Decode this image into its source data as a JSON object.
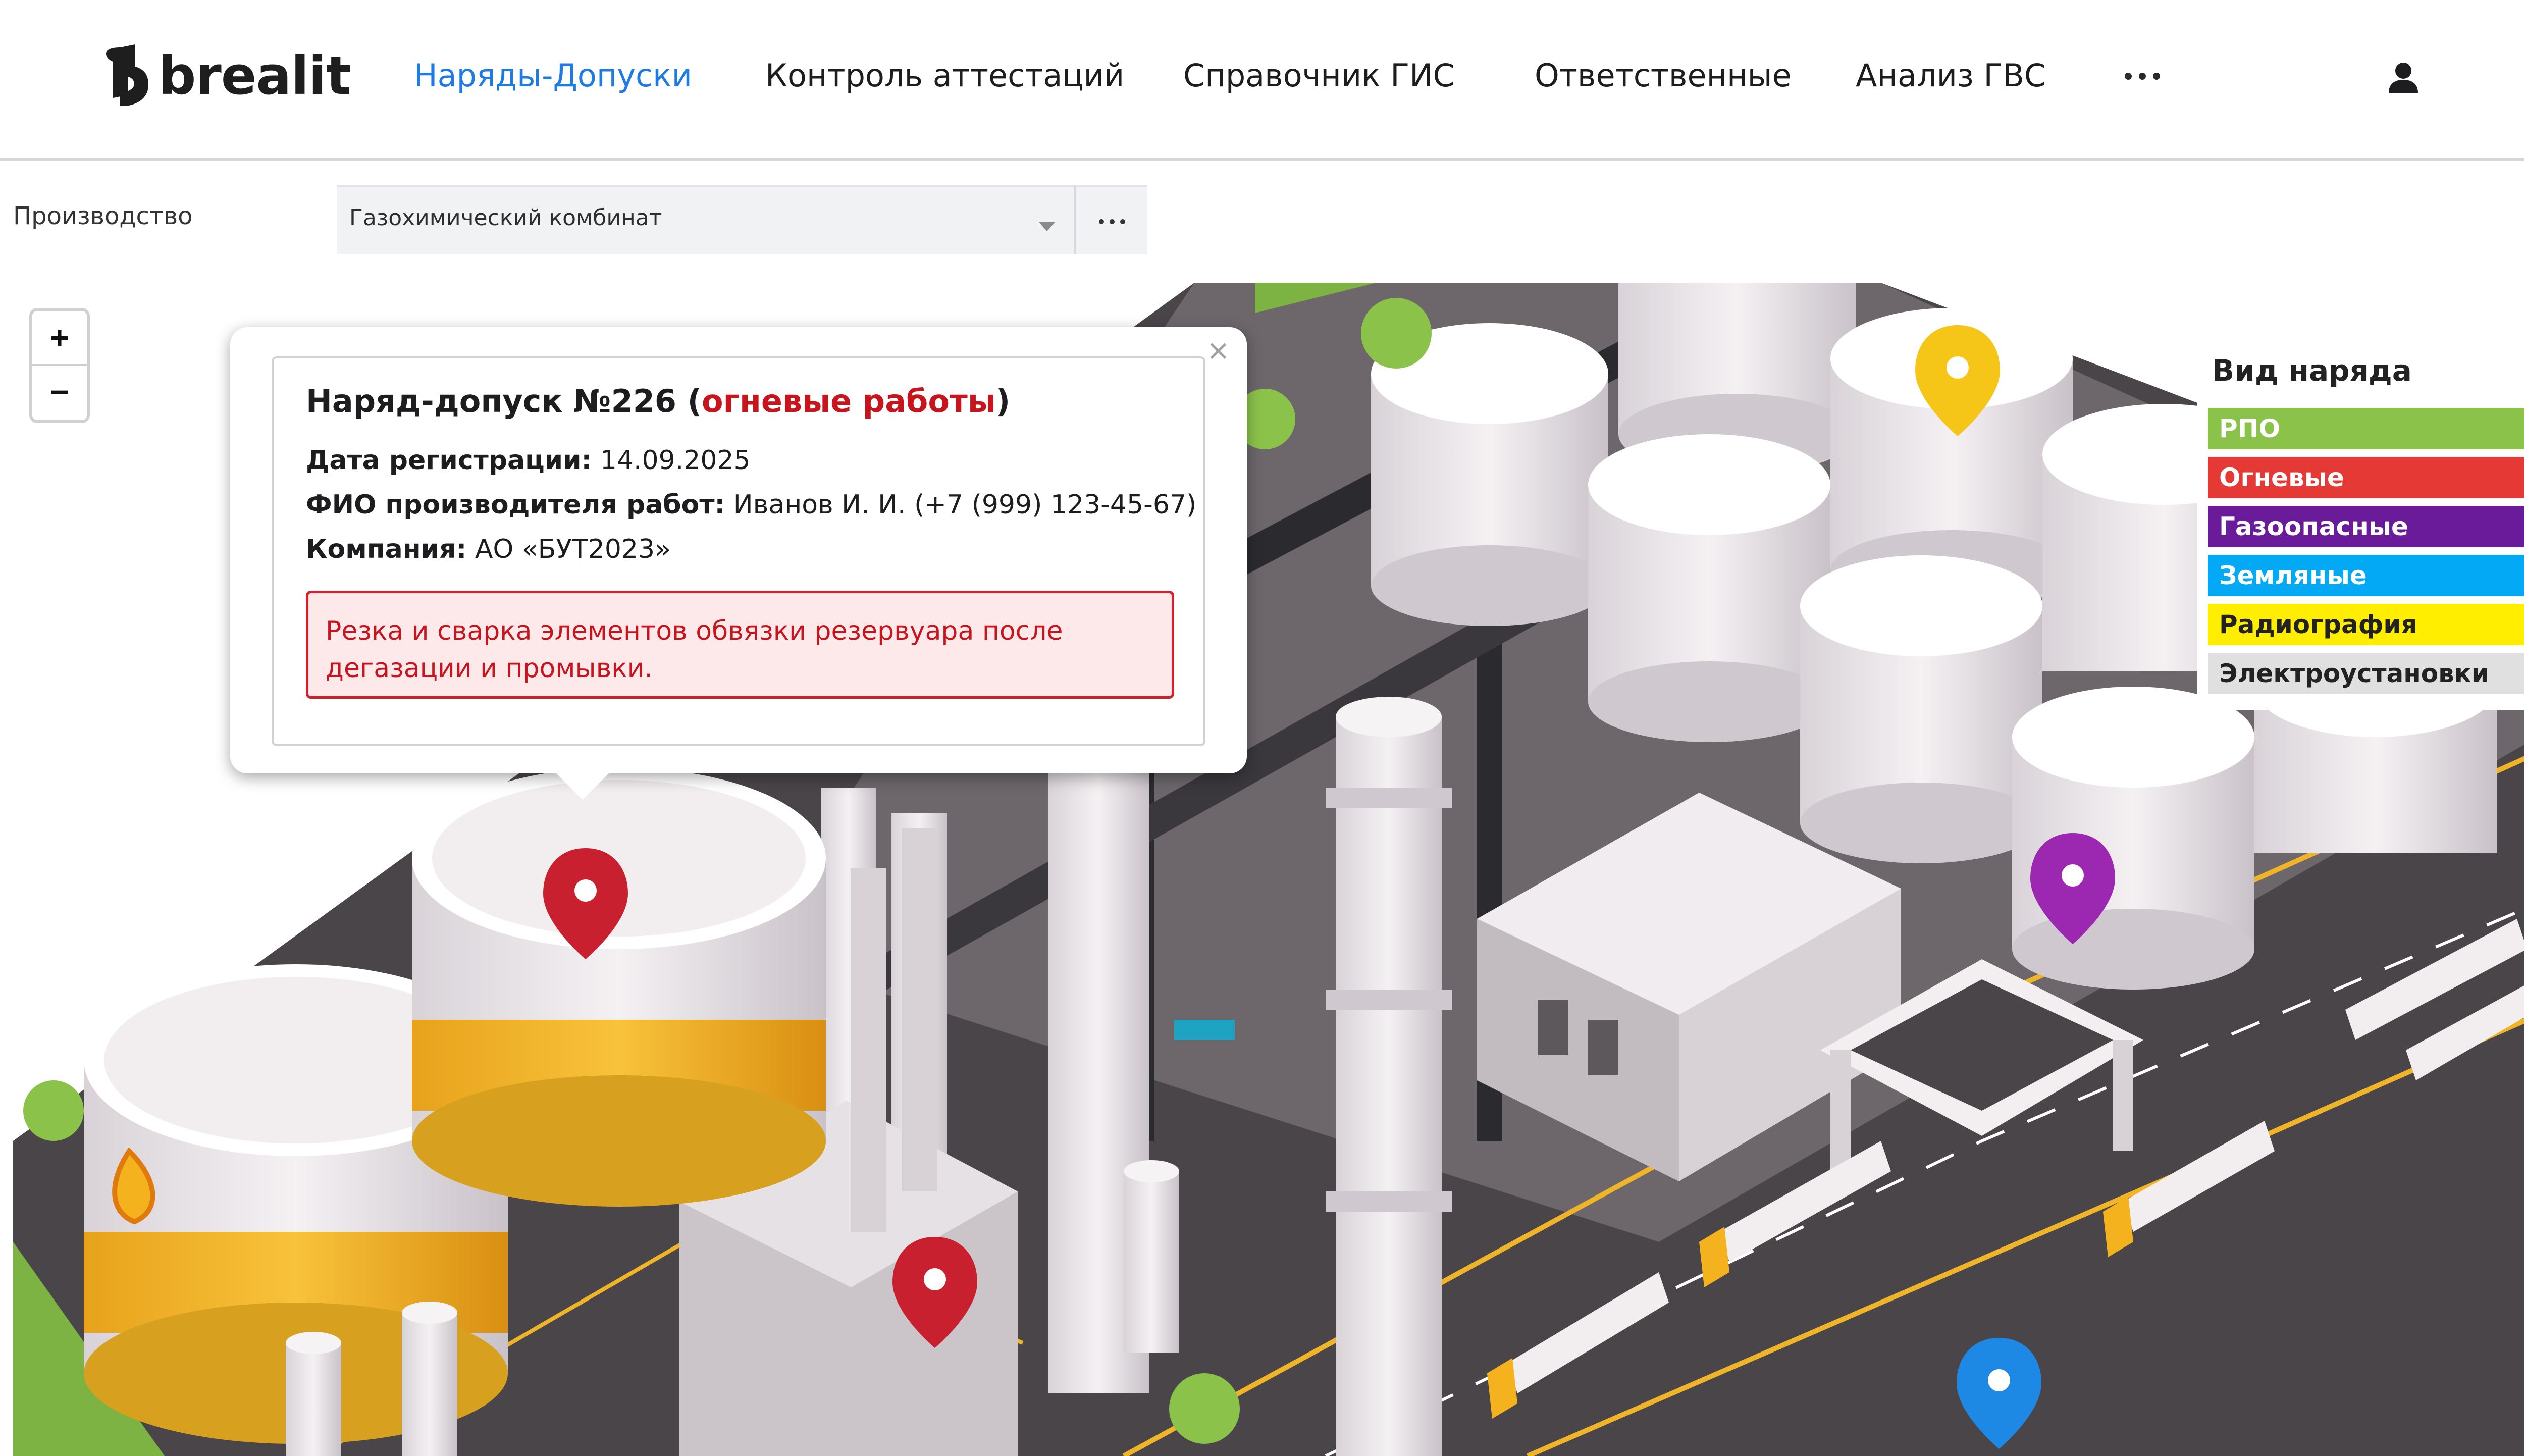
{
  "header": {
    "logo_text": "brealit",
    "nav": [
      {
        "label": "Наряды-Допуски",
        "active": true
      },
      {
        "label": "Контроль аттестаций",
        "active": false
      },
      {
        "label": "Справочник ГИС",
        "active": false
      },
      {
        "label": "Ответственные",
        "active": false
      },
      {
        "label": "Анализ ГВС",
        "active": false
      }
    ],
    "more_icon": "ellipsis-icon",
    "user_icon": "user-icon"
  },
  "filter": {
    "label": "Производство",
    "value": "Газохимический комбинат"
  },
  "map": {
    "zoom_in_label": "+",
    "zoom_out_label": "−"
  },
  "popup": {
    "title_prefix": "Наряд-допуск №226 (",
    "title_type": "огневые работы",
    "title_suffix": ")",
    "close_label": "×",
    "reg_date_label": "Дата регистрации:",
    "reg_date_value": " 14.09.2025",
    "worker_label": "ФИО производителя работ:",
    "worker_value": " Иванов И. И. (+7 (999) 123-45-67)",
    "company_label": "Компания:",
    "company_value": " АО «БУТ2023»",
    "description": "Резка и сварка элементов обвязки резервуара после дегазации и промывки."
  },
  "legend": {
    "title": "Вид наряда",
    "items": [
      {
        "label": "РПО",
        "bg": "#8bc34a",
        "fg": "#ffffff"
      },
      {
        "label": "Огневые",
        "bg": "#e53935",
        "fg": "#ffffff"
      },
      {
        "label": "Газоопасные",
        "bg": "#6a1b9a",
        "fg": "#ffffff"
      },
      {
        "label": "Земляные",
        "bg": "#03a9f4",
        "fg": "#ffffff"
      },
      {
        "label": "Радиография",
        "bg": "#ffee00",
        "fg": "#222222"
      },
      {
        "label": "Электроустановки",
        "bg": "#e0e0e0",
        "fg": "#222222"
      }
    ]
  },
  "markers": [
    {
      "type": "Огневые",
      "color": "#c8202e"
    },
    {
      "type": "Огневые",
      "color": "#c8202e"
    },
    {
      "type": "Радиография",
      "color": "#f5c518"
    },
    {
      "type": "Газоопасные",
      "color": "#9c27b0"
    },
    {
      "type": "Земляные",
      "color": "#1e88e5"
    }
  ],
  "colors": {
    "accent": "#1e7be3",
    "danger": "#c8141c"
  }
}
